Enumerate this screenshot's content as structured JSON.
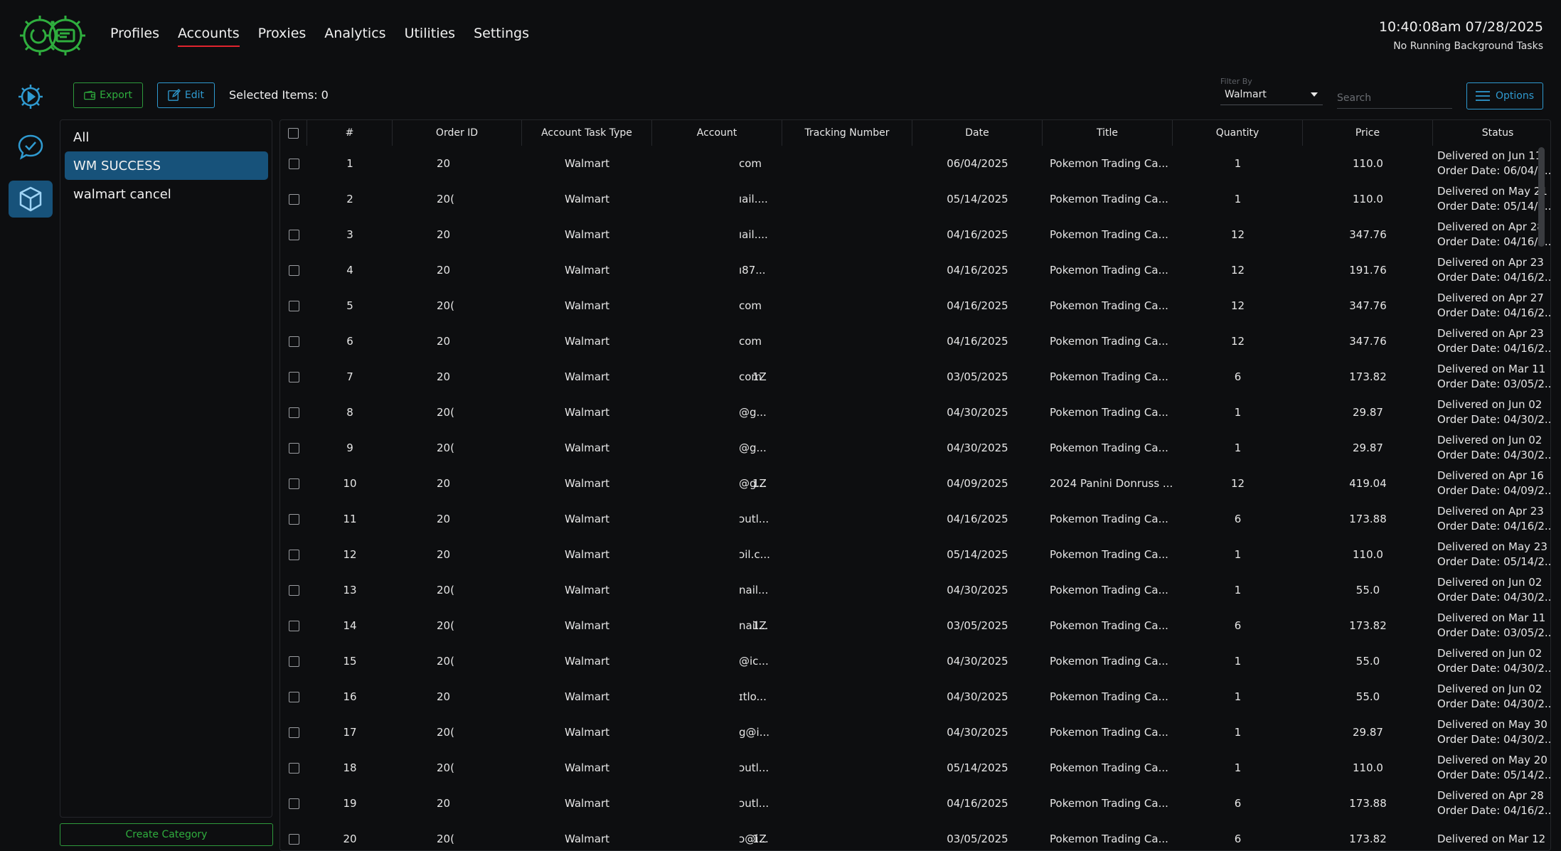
{
  "nav": {
    "items": [
      {
        "label": "Profiles",
        "active": false
      },
      {
        "label": "Accounts",
        "active": true
      },
      {
        "label": "Proxies",
        "active": false
      },
      {
        "label": "Analytics",
        "active": false
      },
      {
        "label": "Utilities",
        "active": false
      },
      {
        "label": "Settings",
        "active": false
      }
    ]
  },
  "header": {
    "datetime": "10:40:08am 07/28/2025",
    "background_status": "No Running Background Tasks"
  },
  "rail": {
    "icons": [
      "gear-play-icon",
      "chat-check-icon",
      "box-icon"
    ],
    "active_index": 2
  },
  "toolbar": {
    "export_label": "Export",
    "edit_label": "Edit",
    "selected_items": "Selected Items: 0",
    "filter_label": "Filter By",
    "filter_value": "Walmart",
    "search_placeholder": "Search",
    "options_label": "Options"
  },
  "categories": {
    "items": [
      {
        "label": "All",
        "active": false
      },
      {
        "label": "WM SUCCESS",
        "active": true
      },
      {
        "label": "walmart cancel",
        "active": false
      }
    ],
    "create_label": "Create Category"
  },
  "table": {
    "columns": [
      "#",
      "Order ID",
      "Account Task Type",
      "Account",
      "Tracking Number",
      "Date",
      "Title",
      "Quantity",
      "Price",
      "Status"
    ],
    "rows": [
      {
        "num": "1",
        "order_id": "20",
        "type": "Walmart",
        "account": "com",
        "tracking": "",
        "date": "06/04/2025",
        "title": "Pokemon Trading Ca...",
        "qty": "1",
        "price": "110.0",
        "status1": "Delivered on Jun 11",
        "status2": "Order Date: 06/04/2..."
      },
      {
        "num": "2",
        "order_id": "20(",
        "type": "Walmart",
        "account": "ıail....",
        "tracking": "",
        "date": "05/14/2025",
        "title": "Pokemon Trading Ca...",
        "qty": "1",
        "price": "110.0",
        "status1": "Delivered on May 21",
        "status2": "Order Date: 05/14/2..."
      },
      {
        "num": "3",
        "order_id": "20",
        "type": "Walmart",
        "account": "ıail....",
        "tracking": "",
        "date": "04/16/2025",
        "title": "Pokemon Trading Ca...",
        "qty": "12",
        "price": "347.76",
        "status1": "Delivered on Apr 28",
        "status2": "Order Date: 04/16/2..."
      },
      {
        "num": "4",
        "order_id": "20",
        "type": "Walmart",
        "account": "ı87...",
        "tracking": "",
        "date": "04/16/2025",
        "title": "Pokemon Trading Ca...",
        "qty": "12",
        "price": "191.76",
        "status1": "Delivered on Apr 23",
        "status2": "Order Date: 04/16/2..."
      },
      {
        "num": "5",
        "order_id": "20(",
        "type": "Walmart",
        "account": "com",
        "tracking": "",
        "date": "04/16/2025",
        "title": "Pokemon Trading Ca...",
        "qty": "12",
        "price": "347.76",
        "status1": "Delivered on Apr 27",
        "status2": "Order Date: 04/16/2..."
      },
      {
        "num": "6",
        "order_id": "20",
        "type": "Walmart",
        "account": "com",
        "tracking": "",
        "date": "04/16/2025",
        "title": "Pokemon Trading Ca...",
        "qty": "12",
        "price": "347.76",
        "status1": "Delivered on Apr 23",
        "status2": "Order Date: 04/16/2..."
      },
      {
        "num": "7",
        "order_id": "20",
        "type": "Walmart",
        "account": "com",
        "tracking": "1Z",
        "date": "03/05/2025",
        "title": "Pokemon Trading Ca...",
        "qty": "6",
        "price": "173.82",
        "status1": "Delivered on Mar 11",
        "status2": "Order Date: 03/05/2..."
      },
      {
        "num": "8",
        "order_id": "20(",
        "type": "Walmart",
        "account": "@g...",
        "tracking": "",
        "date": "04/30/2025",
        "title": "Pokemon Trading Ca...",
        "qty": "1",
        "price": "29.87",
        "status1": "Delivered on Jun 02",
        "status2": "Order Date: 04/30/2..."
      },
      {
        "num": "9",
        "order_id": "20(",
        "type": "Walmart",
        "account": "@g...",
        "tracking": "",
        "date": "04/30/2025",
        "title": "Pokemon Trading Ca...",
        "qty": "1",
        "price": "29.87",
        "status1": "Delivered on Jun 02",
        "status2": "Order Date: 04/30/2..."
      },
      {
        "num": "10",
        "order_id": "20",
        "type": "Walmart",
        "account": "@g...",
        "tracking": "1Z",
        "date": "04/09/2025",
        "title": "2024 Panini Donruss ...",
        "qty": "12",
        "price": "419.04",
        "status1": "Delivered on Apr 16",
        "status2": "Order Date: 04/09/2..."
      },
      {
        "num": "11",
        "order_id": "20",
        "type": "Walmart",
        "account": "ɔutl...",
        "tracking": "",
        "date": "04/16/2025",
        "title": "Pokemon Trading Ca...",
        "qty": "6",
        "price": "173.88",
        "status1": "Delivered on Apr 23",
        "status2": "Order Date: 04/16/2..."
      },
      {
        "num": "12",
        "order_id": "20",
        "type": "Walmart",
        "account": "ɔil.c...",
        "tracking": "",
        "date": "05/14/2025",
        "title": "Pokemon Trading Ca...",
        "qty": "1",
        "price": "110.0",
        "status1": "Delivered on May 23",
        "status2": "Order Date: 05/14/2..."
      },
      {
        "num": "13",
        "order_id": "20(",
        "type": "Walmart",
        "account": "nail...",
        "tracking": "",
        "date": "04/30/2025",
        "title": "Pokemon Trading Ca...",
        "qty": "1",
        "price": "55.0",
        "status1": "Delivered on Jun 02",
        "status2": "Order Date: 04/30/2..."
      },
      {
        "num": "14",
        "order_id": "20(",
        "type": "Walmart",
        "account": "nail...",
        "tracking": "1Z",
        "date": "03/05/2025",
        "title": "Pokemon Trading Ca...",
        "qty": "6",
        "price": "173.82",
        "status1": "Delivered on Mar 11",
        "status2": "Order Date: 03/05/2..."
      },
      {
        "num": "15",
        "order_id": "20(",
        "type": "Walmart",
        "account": "@ic...",
        "tracking": "",
        "date": "04/30/2025",
        "title": "Pokemon Trading Ca...",
        "qty": "1",
        "price": "55.0",
        "status1": "Delivered on Jun 02",
        "status2": "Order Date: 04/30/2..."
      },
      {
        "num": "16",
        "order_id": "20",
        "type": "Walmart",
        "account": "ɪtlo...",
        "tracking": "",
        "date": "04/30/2025",
        "title": "Pokemon Trading Ca...",
        "qty": "1",
        "price": "55.0",
        "status1": "Delivered on Jun 02",
        "status2": "Order Date: 04/30/2..."
      },
      {
        "num": "17",
        "order_id": "20(",
        "type": "Walmart",
        "account": "g@i...",
        "tracking": "",
        "date": "04/30/2025",
        "title": "Pokemon Trading Ca...",
        "qty": "1",
        "price": "29.87",
        "status1": "Delivered on May 30",
        "status2": "Order Date: 04/30/2..."
      },
      {
        "num": "18",
        "order_id": "20(",
        "type": "Walmart",
        "account": "ɔutl...",
        "tracking": "",
        "date": "05/14/2025",
        "title": "Pokemon Trading Ca...",
        "qty": "1",
        "price": "110.0",
        "status1": "Delivered on May 20",
        "status2": "Order Date: 05/14/2..."
      },
      {
        "num": "19",
        "order_id": "20",
        "type": "Walmart",
        "account": "ɔutl...",
        "tracking": "",
        "date": "04/16/2025",
        "title": "Pokemon Trading Ca...",
        "qty": "6",
        "price": "173.88",
        "status1": "Delivered on Apr 28",
        "status2": "Order Date: 04/16/2..."
      },
      {
        "num": "20",
        "order_id": "20(",
        "type": "Walmart",
        "account": "ɔ@i...",
        "tracking": "1Z",
        "date": "03/05/2025",
        "title": "Pokemon Trading Ca...",
        "qty": "6",
        "price": "173.82",
        "status1": "Delivered on Mar 12",
        "status2": ""
      }
    ]
  },
  "colors": {
    "accent_green": "#2fae3e",
    "accent_blue": "#2f9ad0",
    "active_bg": "#17527a",
    "nav_underline": "#e0242e"
  }
}
